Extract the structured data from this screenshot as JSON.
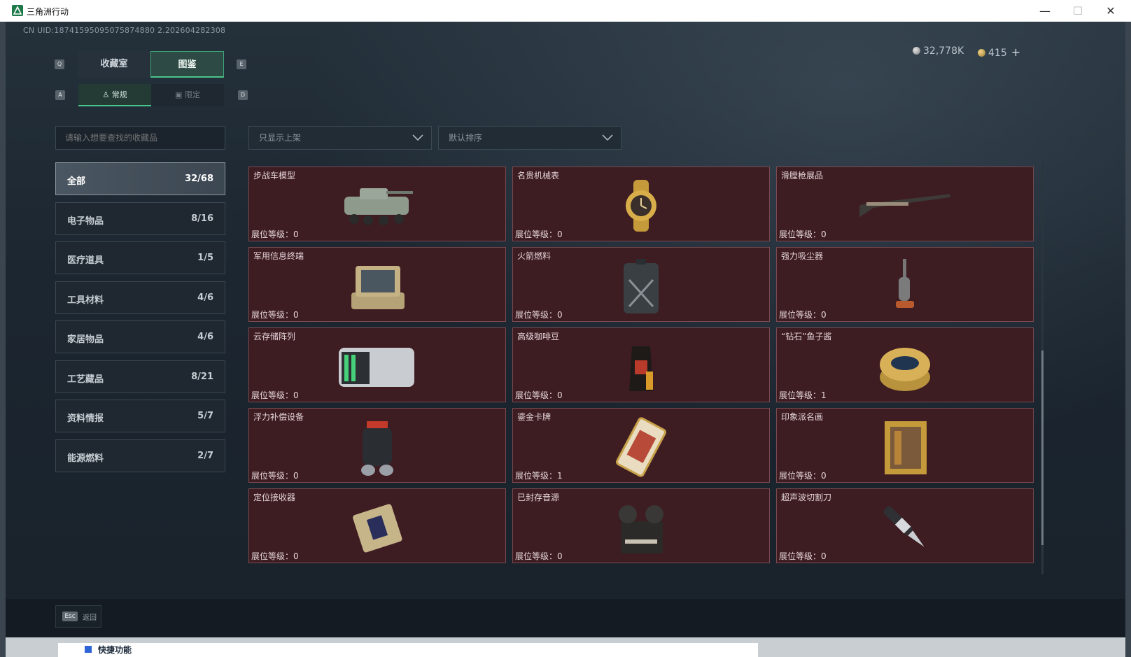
{
  "window": {
    "title": "三角洲行动",
    "min": "—",
    "max": "☐",
    "close": "✕"
  },
  "uid": "CN UID:18741595095075874880 2.202604282308",
  "currency": {
    "silver": "32,778K",
    "gold": "415",
    "plus": "+"
  },
  "keys": {
    "q": "Q",
    "e": "E",
    "a": "A",
    "d": "D"
  },
  "tabs": {
    "collection_room": "收藏室",
    "catalog": "图鉴"
  },
  "subtabs": {
    "regular": "常规",
    "limited": "限定"
  },
  "search": {
    "placeholder": "请输入想要查找的收藏品"
  },
  "filters": {
    "shelf": "只显示上架",
    "sort": "默认排序"
  },
  "categories": [
    {
      "name": "全部",
      "count": "32/68"
    },
    {
      "name": "电子物品",
      "count": "8/16"
    },
    {
      "name": "医疗道具",
      "count": "1/5"
    },
    {
      "name": "工具材料",
      "count": "4/6"
    },
    {
      "name": "家居物品",
      "count": "4/6"
    },
    {
      "name": "工艺藏品",
      "count": "8/21"
    },
    {
      "name": "资料情报",
      "count": "5/7"
    },
    {
      "name": "能源燃料",
      "count": "2/7"
    }
  ],
  "level_label": "展位等级：",
  "items": [
    {
      "name": "步战车模型",
      "level": "0",
      "icon": "ifv-model-icon"
    },
    {
      "name": "名贵机械表",
      "level": "0",
      "icon": "watch-icon"
    },
    {
      "name": "滑膛枪展品",
      "level": "0",
      "icon": "musket-icon"
    },
    {
      "name": "军用信息终端",
      "level": "0",
      "icon": "terminal-icon"
    },
    {
      "name": "火箭燃料",
      "level": "0",
      "icon": "fuel-can-icon"
    },
    {
      "name": "强力吸尘器",
      "level": "0",
      "icon": "vacuum-icon"
    },
    {
      "name": "云存储阵列",
      "level": "0",
      "icon": "storage-array-icon"
    },
    {
      "name": "高级咖啡豆",
      "level": "0",
      "icon": "coffee-bag-icon"
    },
    {
      "name": "“钻石”鱼子酱",
      "level": "1",
      "icon": "caviar-tin-icon"
    },
    {
      "name": "浮力补偿设备",
      "level": "0",
      "icon": "bcd-icon"
    },
    {
      "name": "鎏金卡牌",
      "level": "1",
      "icon": "gold-card-icon"
    },
    {
      "name": "印象派名画",
      "level": "0",
      "icon": "painting-icon"
    },
    {
      "name": "定位接收器",
      "level": "0",
      "icon": "receiver-icon"
    },
    {
      "name": "已封存音源",
      "level": "0",
      "icon": "tape-recorder-icon"
    },
    {
      "name": "超声波切割刀",
      "level": "0",
      "icon": "cutter-icon"
    }
  ],
  "bottom": {
    "esc_key": "Esc",
    "back": "返回"
  },
  "behind": {
    "quick": "快捷功能"
  },
  "colors": {
    "accent": "#48c58b",
    "card_bg": "#3d1c22",
    "card_border": "#7a4a50"
  }
}
